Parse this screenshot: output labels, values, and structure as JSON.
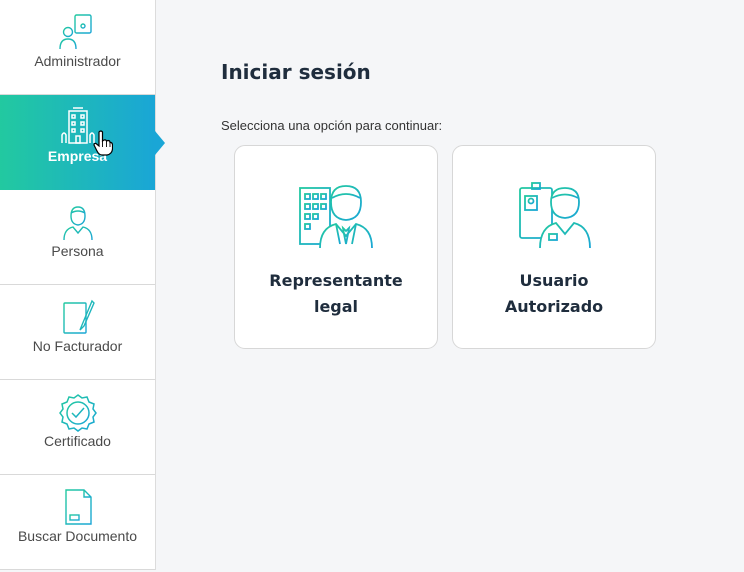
{
  "sidebar": {
    "items": [
      {
        "label": "Administrador",
        "icon": "administrator-icon",
        "active": false
      },
      {
        "label": "Empresa",
        "icon": "building-icon",
        "active": true
      },
      {
        "label": "Persona",
        "icon": "person-icon",
        "active": false
      },
      {
        "label": "No Facturador",
        "icon": "document-pen-icon",
        "active": false
      },
      {
        "label": "Certificado",
        "icon": "certificate-icon",
        "active": false
      },
      {
        "label": "Buscar Documento",
        "icon": "search-document-icon",
        "active": false
      }
    ]
  },
  "main": {
    "title": "Iniciar sesión",
    "subtitle": "Selecciona una opción para continuar:",
    "options": [
      {
        "label_line1": "Representante",
        "label_line2": "legal",
        "icon": "legal-representative-icon"
      },
      {
        "label_line1": "Usuario",
        "label_line2": "Autorizado",
        "icon": "authorized-user-icon"
      }
    ]
  },
  "colors": {
    "accent_start": "#22c9a0",
    "accent_end": "#1aa6d6",
    "icon_stroke": "#1cb5b0",
    "text_dark": "#1f2d3d"
  }
}
